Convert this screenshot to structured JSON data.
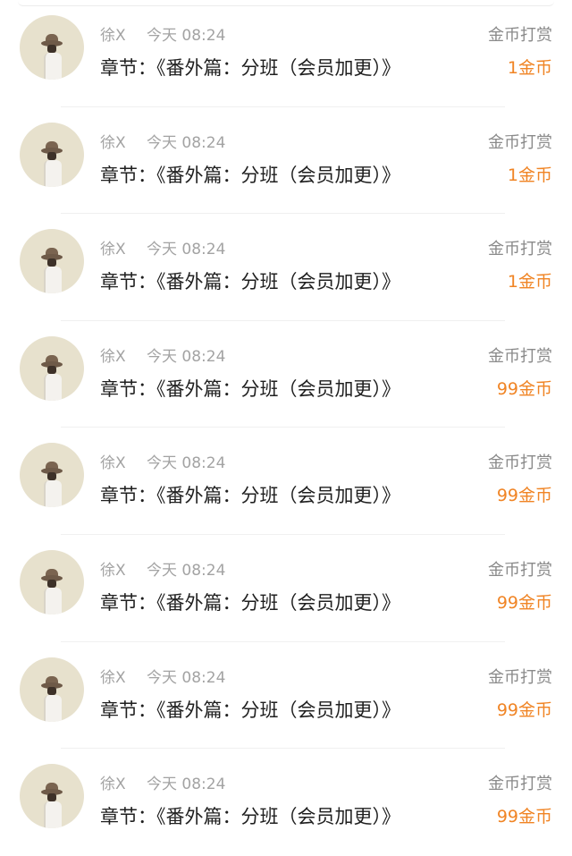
{
  "records": [
    {
      "name": "徐X",
      "time": "今天 08:24",
      "action": "金币打赏",
      "chapter": "章节：《番外篇：分班（会员加更）》",
      "amount": "1金币"
    },
    {
      "name": "徐X",
      "time": "今天 08:24",
      "action": "金币打赏",
      "chapter": "章节：《番外篇：分班（会员加更）》",
      "amount": "1金币"
    },
    {
      "name": "徐X",
      "time": "今天 08:24",
      "action": "金币打赏",
      "chapter": "章节：《番外篇：分班（会员加更）》",
      "amount": "1金币"
    },
    {
      "name": "徐X",
      "time": "今天 08:24",
      "action": "金币打赏",
      "chapter": "章节：《番外篇：分班（会员加更）》",
      "amount": "99金币"
    },
    {
      "name": "徐X",
      "time": "今天 08:24",
      "action": "金币打赏",
      "chapter": "章节：《番外篇：分班（会员加更）》",
      "amount": "99金币"
    },
    {
      "name": "徐X",
      "time": "今天 08:24",
      "action": "金币打赏",
      "chapter": "章节：《番外篇：分班（会员加更）》",
      "amount": "99金币"
    },
    {
      "name": "徐X",
      "time": "今天 08:24",
      "action": "金币打赏",
      "chapter": "章节：《番外篇：分班（会员加更）》",
      "amount": "99金币"
    },
    {
      "name": "徐X",
      "time": "今天 08:24",
      "action": "金币打赏",
      "chapter": "章节：《番外篇：分班（会员加更）》",
      "amount": "99金币"
    }
  ],
  "colors": {
    "amount": "#f08424",
    "secondary_text": "#a3a3a3",
    "primary_text": "#1f1f1f"
  }
}
